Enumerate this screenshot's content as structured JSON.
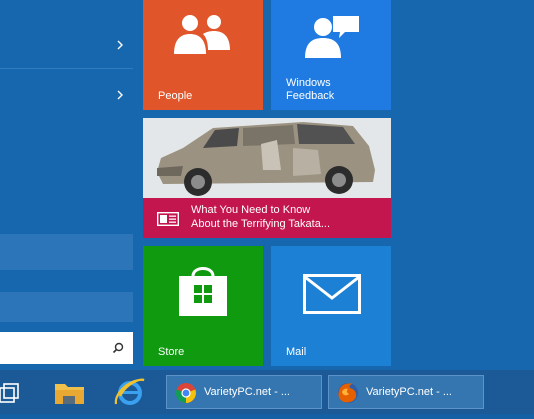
{
  "tiles": {
    "people": {
      "label": "People",
      "icon": "people-icon",
      "color": "#e0562a"
    },
    "feedback": {
      "label_line1": "Windows",
      "label_line2": "Feedback",
      "icon": "feedback-icon",
      "color": "#1f7be2"
    },
    "news": {
      "headline_line1": "What You Need to Know",
      "headline_line2": "About the Terrifying Takata...",
      "icon": "news-icon",
      "color": "#c4164e"
    },
    "store": {
      "label": "Store",
      "icon": "store-bag-icon",
      "color": "#0f9a10"
    },
    "mail": {
      "label": "Mail",
      "icon": "envelope-icon",
      "color": "#1c80d4"
    }
  },
  "search": {
    "value": "",
    "icon": "search-icon"
  },
  "taskbar": {
    "items": [
      {
        "label": "VarietyPC.net - ...",
        "icon": "chrome-icon"
      },
      {
        "label": "VarietyPC.net - ...",
        "icon": "firefox-icon"
      }
    ]
  }
}
